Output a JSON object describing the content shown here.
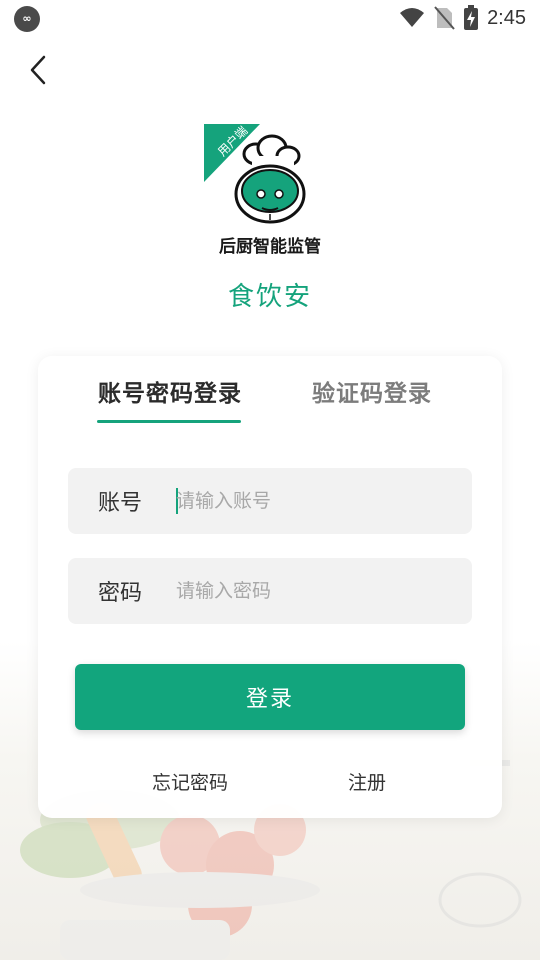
{
  "status_bar": {
    "time": "2:45",
    "icons": [
      "app-indicator-icon",
      "wifi-icon",
      "no-sim-icon",
      "battery-charging-icon"
    ]
  },
  "header": {
    "back_icon": "chevron-left-icon"
  },
  "logo": {
    "badge_text": "用户端",
    "caption": "后厨智能监管"
  },
  "app_name": "食饮安",
  "tabs": [
    {
      "label": "账号密码登录",
      "active": true
    },
    {
      "label": "验证码登录",
      "active": false
    }
  ],
  "form": {
    "account": {
      "label": "账号",
      "placeholder": "请输入账号",
      "value": ""
    },
    "password": {
      "label": "密码",
      "placeholder": "请输入密码",
      "value": ""
    }
  },
  "login_button": "登录",
  "links": {
    "forgot": "忘记密码",
    "register": "注册"
  },
  "colors": {
    "accent": "#12a57d",
    "tab_active": "#2b2b2b",
    "tab_inactive": "#7c7c7c",
    "field_bg": "#f2f2f2"
  }
}
